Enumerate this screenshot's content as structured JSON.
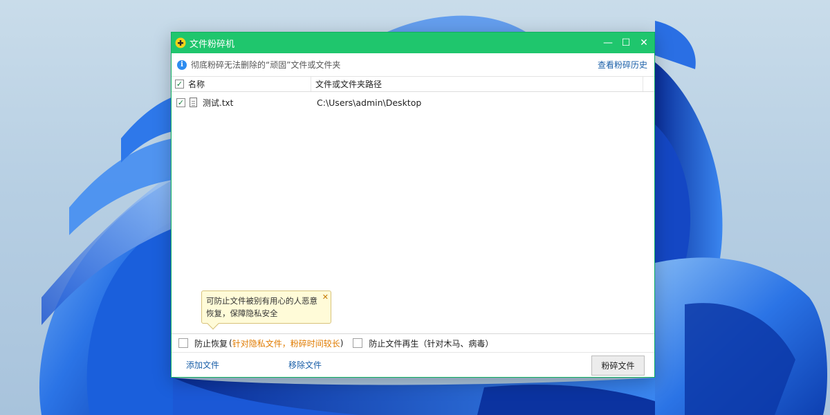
{
  "window": {
    "title": "文件粉碎机",
    "minimize_symbol": "—",
    "maximize_symbol": "☐",
    "close_symbol": "✕"
  },
  "infobar": {
    "icon": "info-icon",
    "icon_glyph": "i",
    "text": "彻底粉碎无法删除的“顽固”文件或文件夹",
    "history_link": "查看粉碎历史"
  },
  "list": {
    "columns": [
      "名称",
      "文件或文件夹路径"
    ],
    "rows": [
      {
        "checked": true,
        "name": "测试.txt",
        "path": "C:\\Users\\admin\\Desktop"
      }
    ]
  },
  "tooltip": {
    "line1": "可防止文件被别有用心的人恶意",
    "line2": "恢复，保障隐私安全",
    "close_symbol": "✕"
  },
  "options": {
    "prevent_recovery": {
      "label": "防止恢复",
      "note_open": "(",
      "note": "针对隐私文件，粉碎时间较长",
      "note_close": ")",
      "checked": false
    },
    "prevent_regen": {
      "label": "防止文件再生（针对木马、病毒）",
      "checked": false
    }
  },
  "footer": {
    "add_files": "添加文件",
    "remove_files": "移除文件",
    "shred_button": "粉碎文件"
  },
  "colors": {
    "titlebar": "#1fc66d",
    "link": "#1a5fa8",
    "note": "#e07b00",
    "wallpaper_blue": "#1e63d8"
  }
}
